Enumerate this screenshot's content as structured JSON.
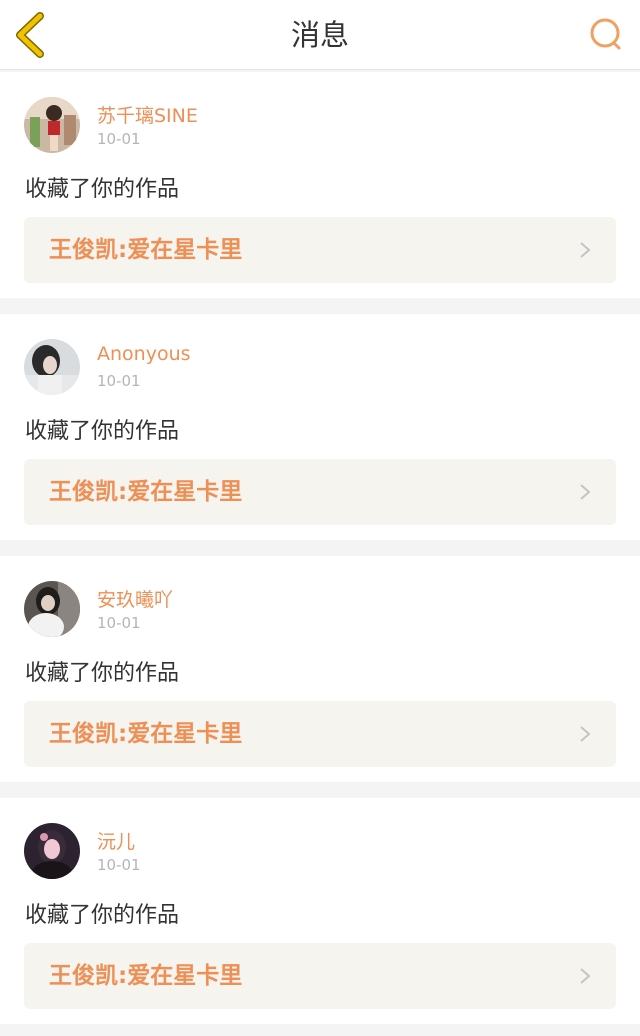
{
  "header": {
    "title": "消息",
    "back_icon": "chevron-left-icon",
    "search_icon": "search-icon",
    "accent": "#e6b800",
    "search_color": "#f0a060"
  },
  "messages": [
    {
      "username": "苏千璃SINE",
      "date": "10-01",
      "action": "收藏了你的作品",
      "work_title": "王俊凯:爱在星卡里"
    },
    {
      "username": "Anonyous",
      "date": "10-01",
      "action": "收藏了你的作品",
      "work_title": "王俊凯:爱在星卡里"
    },
    {
      "username": "安玖曦吖",
      "date": "10-01",
      "action": "收藏了你的作品",
      "work_title": "王俊凯:爱在星卡里"
    },
    {
      "username": "沅儿",
      "date": "10-01",
      "action": "收藏了你的作品",
      "work_title": "王俊凯:爱在星卡里"
    }
  ],
  "colors": {
    "username": "#ee8f55",
    "work_title": "#ee8f55",
    "link_bg": "#f5f4ee",
    "date": "#b5b5b5"
  }
}
